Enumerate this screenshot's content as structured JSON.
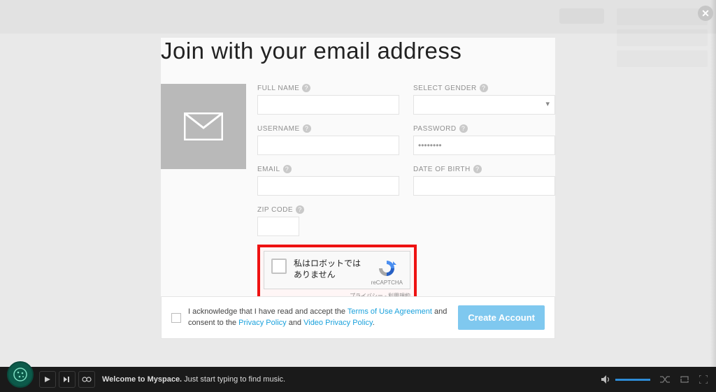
{
  "title": "Join with your email address",
  "close_icon": "✕",
  "form": {
    "fullname": {
      "label": "FULL NAME",
      "value": ""
    },
    "gender": {
      "label": "SELECT GENDER",
      "value": ""
    },
    "username": {
      "label": "USERNAME",
      "value": ""
    },
    "password": {
      "label": "PASSWORD",
      "value": "••••••••"
    },
    "email": {
      "label": "EMAIL",
      "value": ""
    },
    "dob": {
      "label": "DATE OF BIRTH",
      "value": ""
    },
    "zip": {
      "label": "ZIP CODE",
      "value": ""
    }
  },
  "captcha": {
    "text": "私はロボットではありません",
    "brand": "reCAPTCHA",
    "terms": "プライバシー - 利用規約"
  },
  "consent": {
    "pre": "I acknowledge that I have read and accept the ",
    "terms_link": "Terms of Use Agreement",
    "mid": " and consent to the ",
    "privacy_link": "Privacy Policy",
    "and": " and ",
    "video_link": "Video Privacy Policy",
    "end": "."
  },
  "create_button": "Create Account",
  "player": {
    "welcome_bold": "Welcome to Myspace.",
    "welcome_rest": " Just start typing to find music."
  }
}
